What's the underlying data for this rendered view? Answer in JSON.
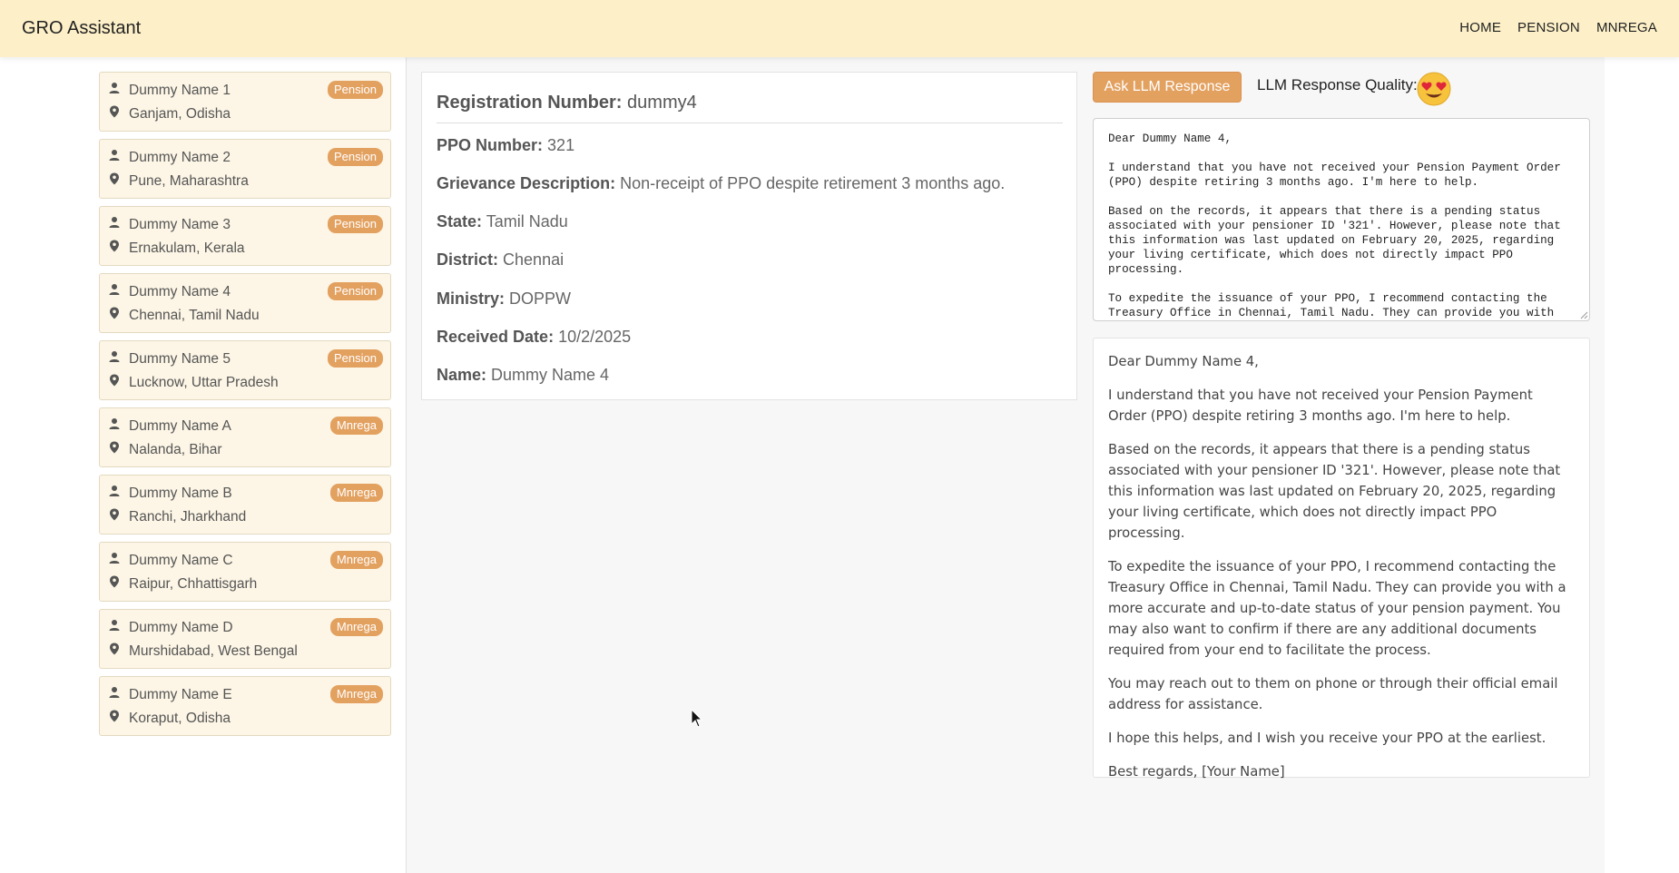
{
  "app": {
    "title": "GRO Assistant"
  },
  "nav": {
    "home": "HOME",
    "pension": "PENSION",
    "mnrega": "MNREGA"
  },
  "sidebar": {
    "items": [
      {
        "name": "Dummy Name 1",
        "location": "Ganjam, Odisha",
        "badge": "Pension"
      },
      {
        "name": "Dummy Name 2",
        "location": "Pune, Maharashtra",
        "badge": "Pension"
      },
      {
        "name": "Dummy Name 3",
        "location": "Ernakulam, Kerala",
        "badge": "Pension"
      },
      {
        "name": "Dummy Name 4",
        "location": "Chennai, Tamil Nadu",
        "badge": "Pension"
      },
      {
        "name": "Dummy Name 5",
        "location": "Lucknow, Uttar Pradesh",
        "badge": "Pension"
      },
      {
        "name": "Dummy Name A",
        "location": "Nalanda, Bihar",
        "badge": "Mnrega"
      },
      {
        "name": "Dummy Name B",
        "location": "Ranchi, Jharkhand",
        "badge": "Mnrega"
      },
      {
        "name": "Dummy Name C",
        "location": "Raipur, Chhattisgarh",
        "badge": "Mnrega"
      },
      {
        "name": "Dummy Name D",
        "location": "Murshidabad, West Bengal",
        "badge": "Mnrega"
      },
      {
        "name": "Dummy Name E",
        "location": "Koraput, Odisha",
        "badge": "Mnrega"
      }
    ]
  },
  "details": {
    "reg_label": "Registration Number:",
    "reg_value": "dummy4",
    "ppo_label": "PPO Number:",
    "ppo_value": "321",
    "grievance_label": "Grievance Description:",
    "grievance_value": "Non-receipt of PPO despite retirement 3 months ago.",
    "state_label": "State:",
    "state_value": "Tamil Nadu",
    "district_label": "District:",
    "district_value": "Chennai",
    "ministry_label": "Ministry:",
    "ministry_value": "DOPPW",
    "date_label": "Received Date:",
    "date_value": "10/2/2025",
    "name_label": "Name:",
    "name_value": "Dummy Name 4"
  },
  "llm": {
    "ask_button": "Ask LLM Response",
    "quality_label": "LLM Response Quality:",
    "quality_icon": "heart-eyes-emoji-icon",
    "textarea_value": "Dear Dummy Name 4,\n\nI understand that you have not received your Pension Payment Order\n(PPO) despite retiring 3 months ago. I'm here to help.\n\nBased on the records, it appears that there is a pending status\nassociated with your pensioner ID '321'. However, please note that\nthis information was last updated on February 20, 2025, regarding\nyour living certificate, which does not directly impact PPO\nprocessing.\n\nTo expedite the issuance of your PPO, I recommend contacting the\nTreasury Office in Chennai, Tamil Nadu. They can provide you with",
    "rendered": {
      "p1": "Dear Dummy Name 4,",
      "p2": "I understand that you have not received your Pension Payment Order (PPO) despite retiring 3 months ago. I'm here to help.",
      "p3": "Based on the records, it appears that there is a pending status associated with your pensioner ID '321'. However, please note that this information was last updated on February 20, 2025, regarding your living certificate, which does not directly impact PPO processing.",
      "p4": "To expedite the issuance of your PPO, I recommend contacting the Treasury Office in Chennai, Tamil Nadu. They can provide you with a more accurate and up-to-date status of your pension payment. You may also want to confirm if there are any additional documents required from your end to facilitate the process.",
      "p5": "You may reach out to them on phone or through their official email address for assistance.",
      "p6": "I hope this helps, and I wish you receive your PPO at the earliest.",
      "p7": "Best regards, [Your Name]"
    }
  },
  "colors": {
    "navbar": "#fdf0c8",
    "accent": "#e3a160",
    "card_bg": "#fdf6e6",
    "content_bg": "#f7f7f7"
  }
}
